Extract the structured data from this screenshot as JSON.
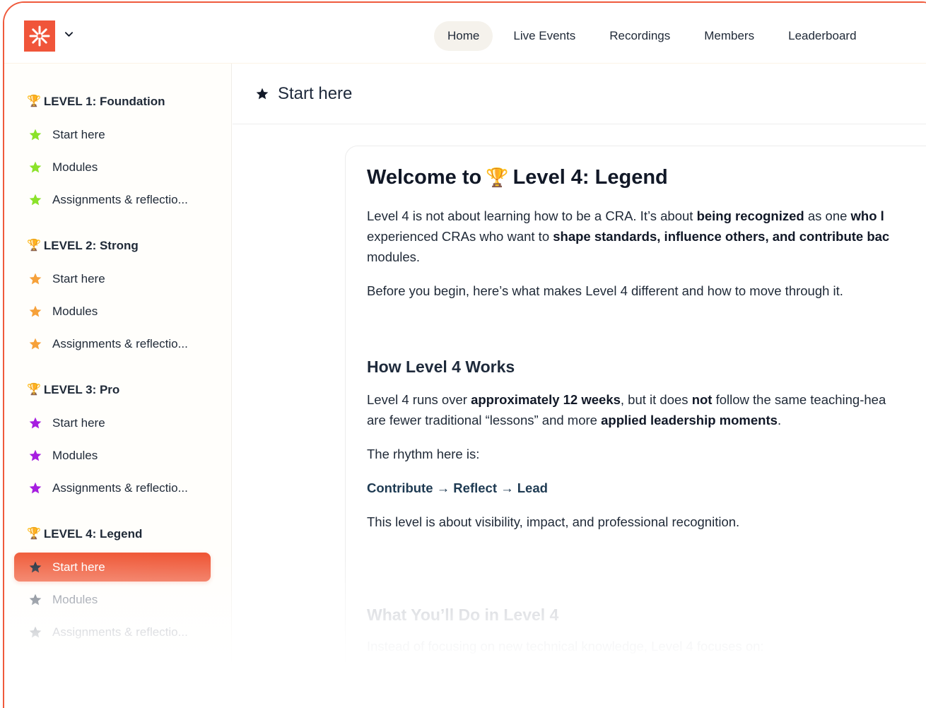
{
  "header": {
    "logo_icon": "asterisk-logo-icon",
    "brand_color": "#f0553a",
    "nav": [
      {
        "label": "Home",
        "active": true
      },
      {
        "label": "Live Events",
        "active": false
      },
      {
        "label": "Recordings",
        "active": false
      },
      {
        "label": "Members",
        "active": false
      },
      {
        "label": "Leaderboard",
        "active": false
      }
    ]
  },
  "sidebar": {
    "groups": [
      {
        "title": "LEVEL 1: Foundation",
        "star_color": "#8be22a",
        "items": [
          "Start here",
          "Modules",
          "Assignments & reflectio..."
        ]
      },
      {
        "title": "LEVEL 2: Strong",
        "star_color": "#f6a13a",
        "items": [
          "Start here",
          "Modules",
          "Assignments & reflectio..."
        ]
      },
      {
        "title": "LEVEL 3: Pro",
        "star_color": "#a61ee0",
        "items": [
          "Start here",
          "Modules",
          "Assignments & reflectio..."
        ]
      },
      {
        "title": "LEVEL 4: Legend",
        "star_color": "#4b5563",
        "items": [
          "Start here",
          "Modules",
          "Assignments & reflectio..."
        ],
        "active_index": 0
      }
    ]
  },
  "main": {
    "page_title": "Start here",
    "welcome_prefix": "Welcome to",
    "welcome_suffix": "Level 4: Legend",
    "intro": {
      "l1_a": "Level 4 is not about learning how to be a CRA. It’s about ",
      "l1_b": "being recognized",
      "l1_c": " as one ",
      "l1_d": "who l",
      "l2_a": "experienced CRAs who want to ",
      "l2_b": "shape standards, influence others, and contribute bac",
      "l3": "modules."
    },
    "before": "Before you begin, here’s what makes Level 4 different and how to move through it.",
    "works_title": "How Level 4 Works",
    "works": {
      "l1_a": "Level 4 runs over ",
      "l1_b": "approximately 12 weeks",
      "l1_c": ", but it does ",
      "l1_d": "not",
      "l1_e": " follow the same teaching-hea",
      "l2_a": "are fewer traditional “lessons” and more ",
      "l2_b": "applied leadership moments",
      "l2_c": "."
    },
    "rhythm_intro": "The rhythm here is:",
    "rhythm": "Contribute → Reflect → Lead",
    "visibility": "This level is about visibility, impact, and professional recognition.",
    "next_title": "What You’ll Do in Level 4",
    "next_line": "Instead of focusing on new technical knowledge, Level 4 focuses on:"
  }
}
